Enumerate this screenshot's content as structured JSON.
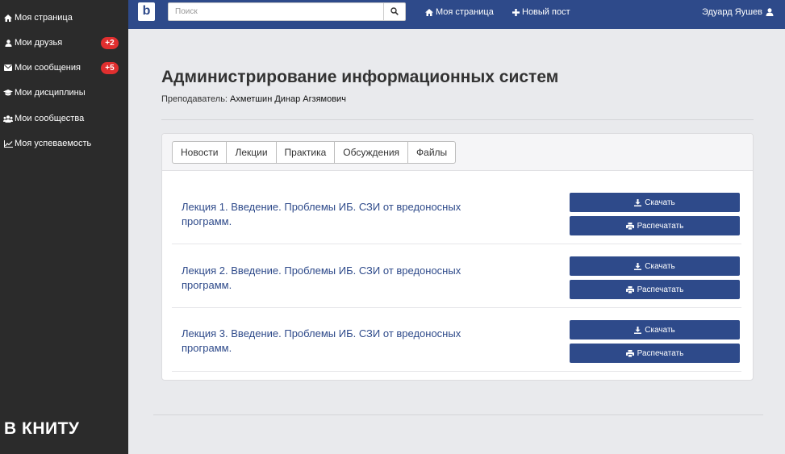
{
  "sidebar": {
    "items": [
      {
        "label": "Моя страница",
        "icon": "home-icon"
      },
      {
        "label": "Мои друзья",
        "icon": "user-icon",
        "badge": "+2"
      },
      {
        "label": "Мои сообщения",
        "icon": "envelope-icon",
        "badge": "+5"
      },
      {
        "label": "Мои дисциплины",
        "icon": "graduation-cap-icon"
      },
      {
        "label": "Мои сообщества",
        "icon": "users-icon"
      },
      {
        "label": "Моя успеваемость",
        "icon": "line-chart-icon"
      }
    ],
    "brand": "В КНИТУ"
  },
  "navbar": {
    "logo": "b",
    "search_placeholder": "Поиск",
    "home_label": "Моя страница",
    "new_post_label": "Новый пост",
    "user_name": "Эдуард Яушев"
  },
  "main": {
    "title": "Администрирование информационных систем",
    "teacher_label": "Преподаватель:",
    "teacher_name": "Ахметшин Динар Агзямович",
    "tabs": [
      "Новости",
      "Лекции",
      "Практика",
      "Обсуждения",
      "Файлы"
    ],
    "lectures": [
      {
        "title": "Лекция 1. Введение. Проблемы ИБ. СЗИ от вредоносных программ.",
        "download_label": "Скачать",
        "print_label": "Распечатать"
      },
      {
        "title": "Лекция 2. Введение. Проблемы ИБ. СЗИ от вредоносных программ.",
        "download_label": "Скачать",
        "print_label": "Распечатать"
      },
      {
        "title": "Лекция 3. Введение. Проблемы ИБ. СЗИ от вредоносных программ.",
        "download_label": "Скачать",
        "print_label": "Распечатать"
      }
    ]
  },
  "colors": {
    "navbar": "#2e4a8a",
    "sidebar": "#2b2b2b",
    "badge": "#e02f2f",
    "button": "#2e4a8a",
    "background": "#e9eaed"
  }
}
